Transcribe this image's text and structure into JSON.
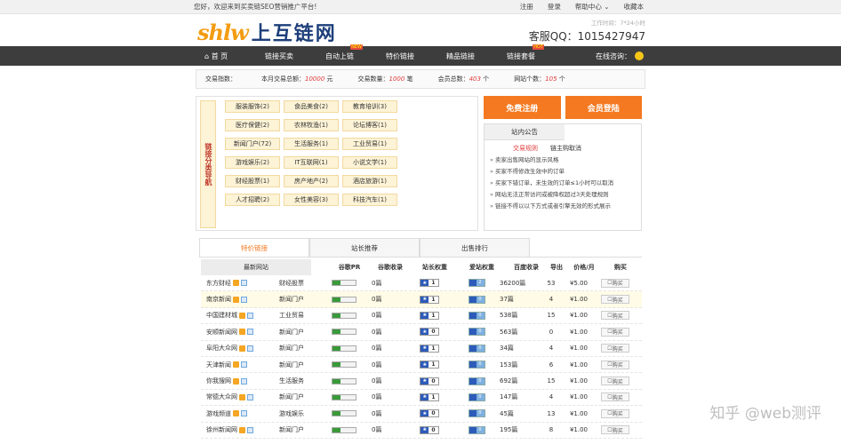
{
  "topbar": {
    "welcome": "您好，欢迎来到买卖链SEO营销推广平台!",
    "links": [
      "注册",
      "登录",
      "帮助中心 ⌄",
      "收藏本"
    ]
  },
  "header": {
    "logo_mark": "shlw",
    "logo_text": "上互链网",
    "service_hours": "工作时间：7*24小时",
    "service_qq": "客服QQ：1015427947"
  },
  "nav": {
    "home": "首 页",
    "items": [
      "链接买卖",
      "自动上链",
      "特价链接",
      "精品链接",
      "链接套餐"
    ],
    "badges": {
      "auto": "NEW",
      "package": "HOT"
    },
    "consult": "在线咨询："
  },
  "stats": {
    "label": "交易指数：",
    "month_total_label": "本月交易总额：",
    "month_total_value": "10000",
    "month_total_unit": "元",
    "trade_count_label": "交易数量：",
    "trade_count_value": "1000",
    "trade_count_unit": "笔",
    "members_label": "会员总数：",
    "members_value": "403",
    "members_unit": "个",
    "sites_label": "网站个数：",
    "sites_value": "105",
    "sites_unit": "个"
  },
  "categories": {
    "label": "链接分类导航",
    "items": [
      "服装服饰(2)",
      "食品美食(2)",
      "教育培训(3)",
      "医疗保健(2)",
      "农林牧渔(1)",
      "论坛博客(1)",
      "新闻门户(72)",
      "生活服务(1)",
      "工业贸易(1)",
      "游戏娱乐(2)",
      "IT互联网(1)",
      "小说文学(1)",
      "财经股票(1)",
      "房产地产(2)",
      "酒店旅游(1)",
      "人才招聘(2)",
      "女性美容(3)",
      "科技汽车(1)"
    ]
  },
  "actions": {
    "register": "免费注册",
    "login": "会员登陆"
  },
  "notice": {
    "title": "站内公告",
    "tab_active": "交易规则",
    "tab_other": "链主购取消",
    "items": [
      "卖家出售网站的显示风格",
      "买家不得修改生效中的订单",
      "买家下错订单，未生效的订单≤1小时可以取消",
      "网站无法正常访问或被降权超过3天处理规则",
      "链接不得以以下方式或者引擎无效的形式展示"
    ]
  },
  "tabs": [
    "特价链接",
    "站长推荐",
    "出售排行"
  ],
  "table": {
    "headers": {
      "site": "最新网站",
      "pr": "谷歌PR",
      "google": "谷歌收录",
      "sw": "站长权重",
      "mb": "爱站权重",
      "baidu": "百度收录",
      "out": "导出",
      "price": "价格/月",
      "buy": "购买"
    },
    "rows": [
      {
        "name": "东方财经",
        "cat": "财经股票",
        "pr": 0.35,
        "google": "0篇",
        "sw": "1",
        "mb": "2",
        "baidu": "36200篇",
        "out": "53",
        "price": "¥5.00",
        "buy": "购买"
      },
      {
        "name": "南京新闻",
        "cat": "新闻门户",
        "pr": 0.35,
        "google": "0篇",
        "sw": "1",
        "mb": "0",
        "baidu": "37篇",
        "out": "4",
        "price": "¥1.00",
        "buy": "购买"
      },
      {
        "name": "中国建材城",
        "cat": "工业贸易",
        "pr": 0.35,
        "google": "0篇",
        "sw": "1",
        "mb": "0",
        "baidu": "538篇",
        "out": "15",
        "price": "¥1.00",
        "buy": "购买"
      },
      {
        "name": "安顺新闻网",
        "cat": "新闻门户",
        "pr": 0.35,
        "google": "0篇",
        "sw": "0",
        "mb": "0",
        "baidu": "563篇",
        "out": "0",
        "price": "¥1.00",
        "buy": "购买"
      },
      {
        "name": "阜阳大众网",
        "cat": "新闻门户",
        "pr": 0.35,
        "google": "0篇",
        "sw": "1",
        "mb": "0",
        "baidu": "34篇",
        "out": "4",
        "price": "¥1.00",
        "buy": "购买"
      },
      {
        "name": "天津新闻",
        "cat": "新闻门户",
        "pr": 0.35,
        "google": "0篇",
        "sw": "1",
        "mb": "0",
        "baidu": "153篇",
        "out": "6",
        "price": "¥1.00",
        "buy": "购买"
      },
      {
        "name": "你我搜网",
        "cat": "生活服务",
        "pr": 0.35,
        "google": "0篇",
        "sw": "0",
        "mb": "0",
        "baidu": "692篇",
        "out": "15",
        "price": "¥1.00",
        "buy": "购买"
      },
      {
        "name": "常德大众网",
        "cat": "新闻门户",
        "pr": 0.35,
        "google": "0篇",
        "sw": "1",
        "mb": "0",
        "baidu": "147篇",
        "out": "4",
        "price": "¥1.00",
        "buy": "购买"
      },
      {
        "name": "游戏频道",
        "cat": "游戏娱乐",
        "pr": 0.35,
        "google": "0篇",
        "sw": "0",
        "mb": "0",
        "baidu": "45篇",
        "out": "13",
        "price": "¥1.00",
        "buy": "购买"
      },
      {
        "name": "徐州新闻网",
        "cat": "新闻门户",
        "pr": 0.35,
        "google": "0篇",
        "sw": "0",
        "mb": "0",
        "baidu": "195篇",
        "out": "8",
        "price": "¥1.00",
        "buy": "购买"
      }
    ]
  },
  "watermark": "知乎 @web测评",
  "colors": {
    "accent": "#f47920",
    "nav_bg": "#3d3d3d",
    "highlight": "#e03c3c"
  }
}
